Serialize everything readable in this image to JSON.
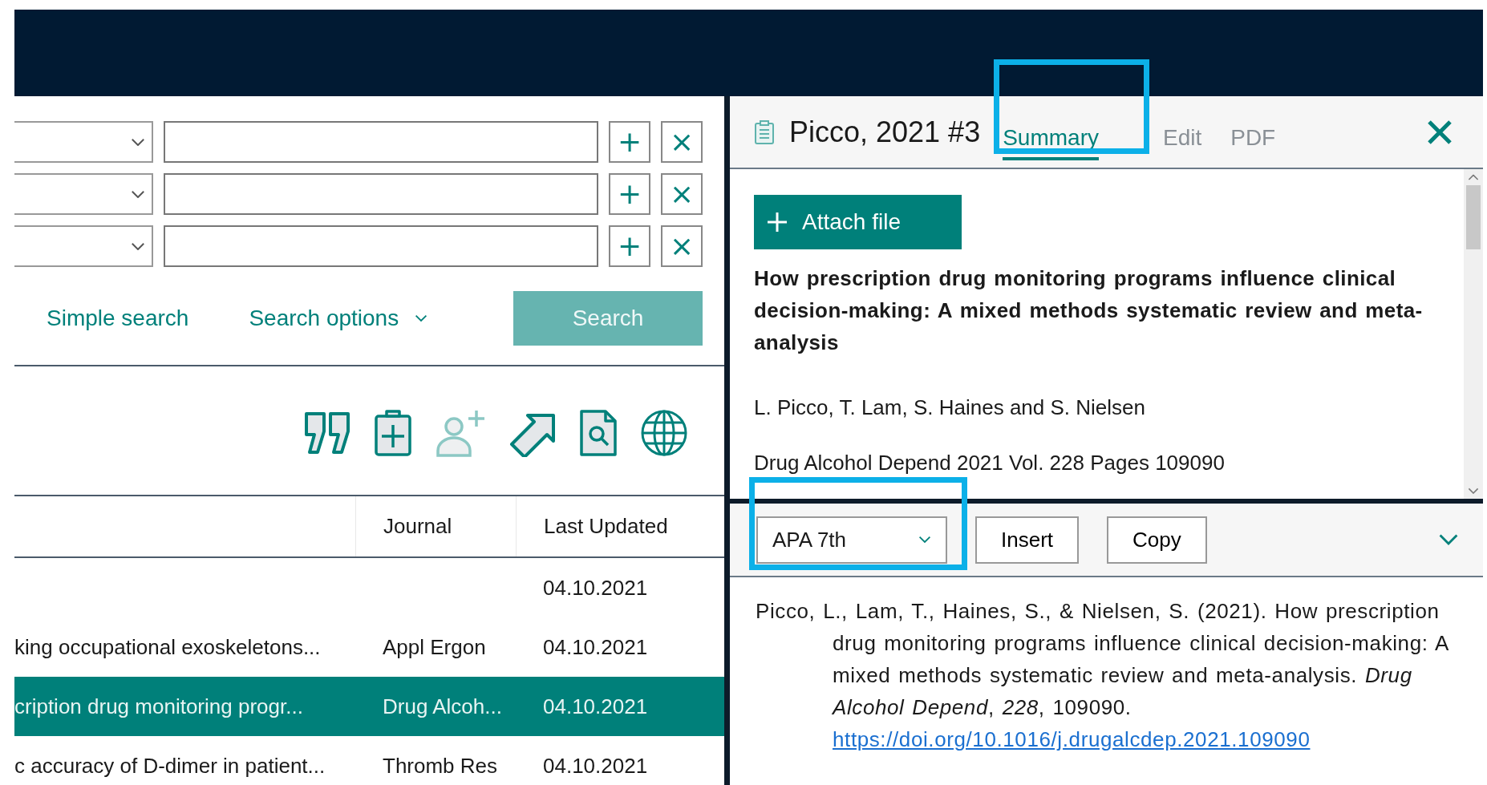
{
  "search": {
    "criteria_rows": [
      {
        "add": "+",
        "remove": "×"
      },
      {
        "add": "+",
        "remove": "×"
      },
      {
        "add": "+",
        "remove": "×"
      }
    ],
    "simple_search_link": "Simple search",
    "search_options": "Search options",
    "search_button": {
      "label": "Search",
      "disabled": true
    }
  },
  "toolbar": [
    {
      "kind": "quote",
      "disabled": false
    },
    {
      "kind": "clipboard-plus",
      "disabled": false
    },
    {
      "kind": "person-plus",
      "disabled": true
    },
    {
      "kind": "arrow",
      "disabled": false
    },
    {
      "kind": "document-search",
      "disabled": false
    },
    {
      "kind": "globe",
      "disabled": false
    }
  ],
  "table": {
    "headers": {
      "journal": "Journal",
      "last_updated": "Last Updated"
    },
    "rows": [
      {
        "last_updated": "04.10.2021",
        "selected": false
      },
      {
        "column_1": "king occupational exoskeletons...",
        "journal": "Appl Ergon",
        "last_updated": "04.10.2021",
        "selected": false
      },
      {
        "column_1": "cription drug monitoring progr...",
        "journal": "Drug Alcoh...",
        "last_updated": "04.10.2021",
        "selected": true
      },
      {
        "column_1": "c accuracy of D-dimer in patient...",
        "journal": "Thromb Res",
        "last_updated": "04.10.2021",
        "selected": false
      }
    ]
  },
  "detail": {
    "title": "Picco, 2021 #3",
    "tabs": [
      {
        "label": "Summary",
        "selected": true,
        "highlighted": true
      },
      {
        "label": "Edit",
        "selected": false,
        "highlighted": false
      },
      {
        "label": "PDF",
        "selected": false,
        "highlighted": false
      }
    ],
    "attach_button": "Attach file",
    "article_title": "How prescription drug monitoring programs influence clinical decision-making: A mixed methods systematic review and meta-analysis",
    "authors": "L. Picco, T. Lam, S. Haines and S. Nielsen",
    "source": "Drug Alcohol Depend 2021 Vol. 228 Pages 109090"
  },
  "citation": {
    "style": "APA 7th",
    "style_highlighted": true,
    "buttons": [
      "Insert",
      "Copy"
    ],
    "text": "Picco, L., Lam, T., Haines, S., & Nielsen, S. (2021). How prescription drug monitoring programs influence clinical decision-making: A mixed methods systematic review and meta-analysis. *Drug Alcohol Depend*, *228*, 109090.",
    "link": "https://doi.org/10.1016/j.drugalcdep.2021.109090"
  }
}
